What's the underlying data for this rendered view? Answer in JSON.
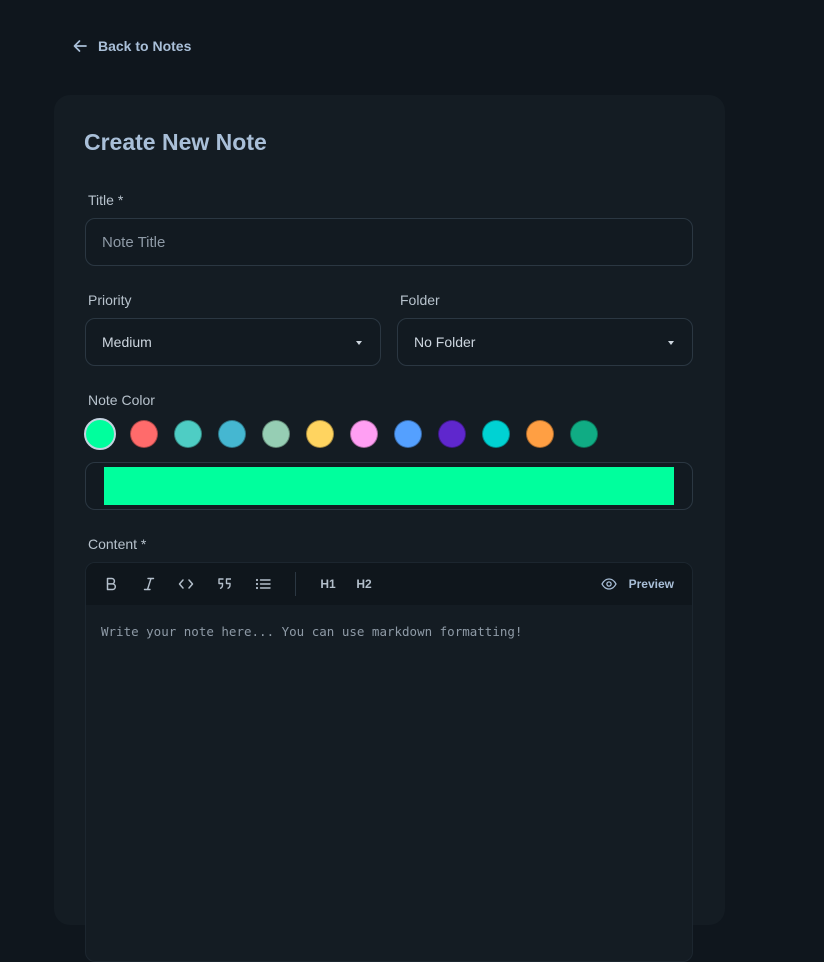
{
  "nav": {
    "back_label": "Back to Notes"
  },
  "form": {
    "heading": "Create New Note",
    "title_label": "Title *",
    "title_placeholder": "Note Title",
    "priority_label": "Priority",
    "priority_value": "Medium",
    "folder_label": "Folder",
    "folder_value": "No Folder",
    "color_label": "Note Color",
    "colors": [
      "#00ff9d",
      "#ff6b6b",
      "#4ecdc4",
      "#45b7d1",
      "#96ceb4",
      "#ffd460",
      "#ff9ff3",
      "#54a0ff",
      "#5f27cd",
      "#00d2d3",
      "#ff9f43",
      "#10ac84"
    ],
    "selected_color": "#00ff9d",
    "content_label": "Content *",
    "content_placeholder": "Write your note here... You can use markdown formatting!"
  },
  "toolbar": {
    "items": [
      {
        "name": "bold-icon",
        "glyph": "B"
      },
      {
        "name": "italic-icon",
        "glyph": "I"
      },
      {
        "name": "code-icon",
        "glyph": "<>"
      },
      {
        "name": "quote-icon",
        "glyph": "quote"
      },
      {
        "name": "list-icon",
        "glyph": "list"
      }
    ],
    "h1_label": "H1",
    "h2_label": "H2",
    "preview_label": "Preview"
  }
}
